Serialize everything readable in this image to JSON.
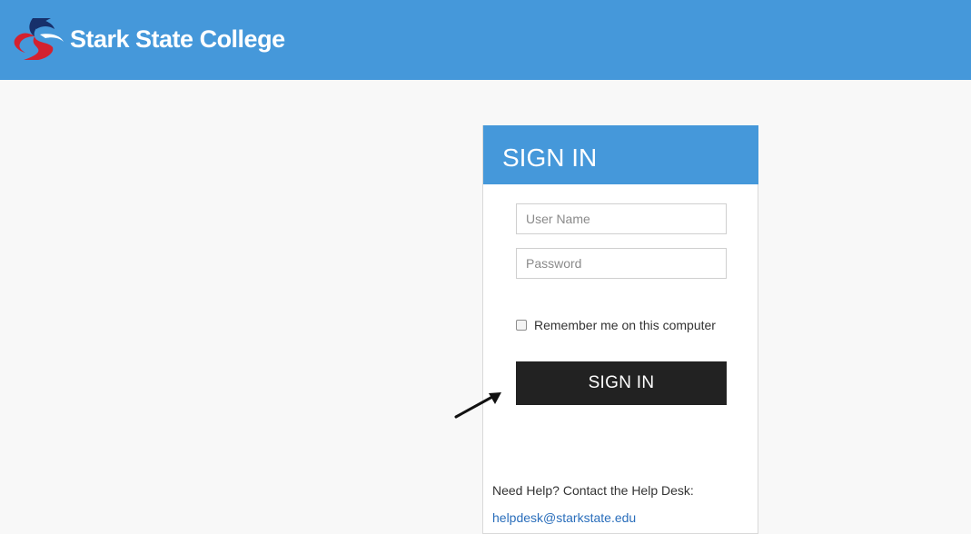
{
  "header": {
    "brand_name": "Stark State College",
    "logo_icon": "stark-state-swoosh-icon",
    "background_color": "#4598da"
  },
  "signin_card": {
    "title": "SIGN IN",
    "username_placeholder": "User Name",
    "password_placeholder": "Password",
    "remember_label": "Remember me on this computer",
    "remember_checked": false,
    "submit_label": "SIGN IN",
    "help_text": "Need Help? Contact the Help Desk:",
    "help_email": "helpdesk@starkstate.edu",
    "accent_color": "#4598da",
    "button_color": "#222222",
    "link_color": "#2a6ebb"
  },
  "annotation": {
    "icon": "arrow-pointer-icon"
  }
}
